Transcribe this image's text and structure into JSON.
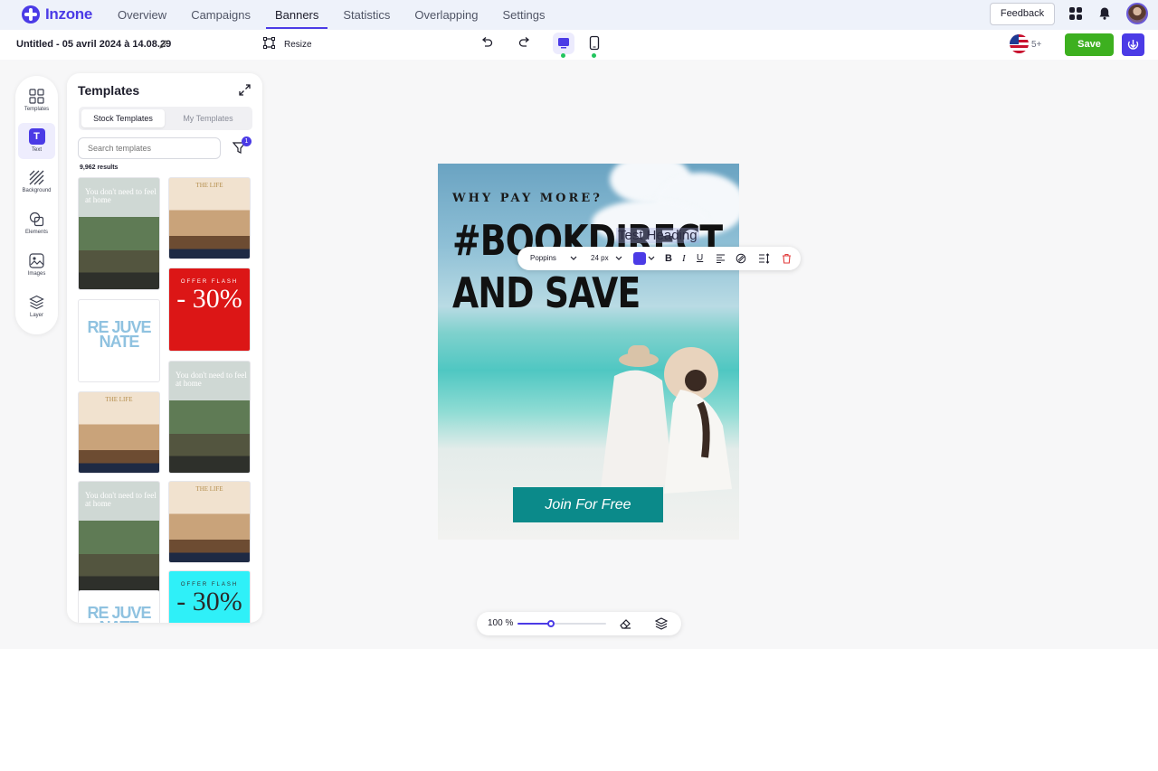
{
  "app": {
    "name": "Inzone"
  },
  "nav": {
    "tabs": [
      {
        "label": "Overview"
      },
      {
        "label": "Campaigns"
      },
      {
        "label": "Banners"
      },
      {
        "label": "Statistics"
      },
      {
        "label": "Overlapping"
      },
      {
        "label": "Settings"
      }
    ],
    "active_tab": "Banners",
    "feedback_label": "Feedback"
  },
  "toolbar": {
    "doc_title": "Untitled - 05 avril 2024 à 14.08.29",
    "resize_label": "Resize",
    "language_count": "5+",
    "save_label": "Save"
  },
  "rail": {
    "items": [
      {
        "label": "Templates",
        "icon": "templates-icon"
      },
      {
        "label": "Text",
        "icon": "text-icon"
      },
      {
        "label": "Background",
        "icon": "background-icon"
      },
      {
        "label": "Elements",
        "icon": "elements-icon"
      },
      {
        "label": "Images",
        "icon": "images-icon"
      },
      {
        "label": "Layer",
        "icon": "layer-icon"
      }
    ],
    "active": "Text"
  },
  "panel": {
    "title": "Templates",
    "tabs": [
      "Stock Templates",
      "My Templates"
    ],
    "search_placeholder": "Search templates",
    "filter_count": "1",
    "result_count": "9,962 results",
    "thumbs": {
      "resort_text": "You don't need to feel at home",
      "life_text": "THE LIFE",
      "offer_label": "OFFER FLASH",
      "offer_value": "- 30%",
      "rj_text": "RE JUVE NATE"
    }
  },
  "canvas": {
    "subheading": "WHY PAY MORE?",
    "headline_line1": "#BOOKDIRECT",
    "headline_line2": "AND SAVE",
    "overlay_text": "Test Heading",
    "cta_label": "Join For Free"
  },
  "text_toolbar": {
    "font": "Poppins",
    "size": "24 px",
    "color": "#4b3be6"
  },
  "zoom": {
    "label": "100 %",
    "level": 0.38
  },
  "colors": {
    "accent": "#4b3be6",
    "save": "#3db01f",
    "cta": "#0b8a8a"
  }
}
